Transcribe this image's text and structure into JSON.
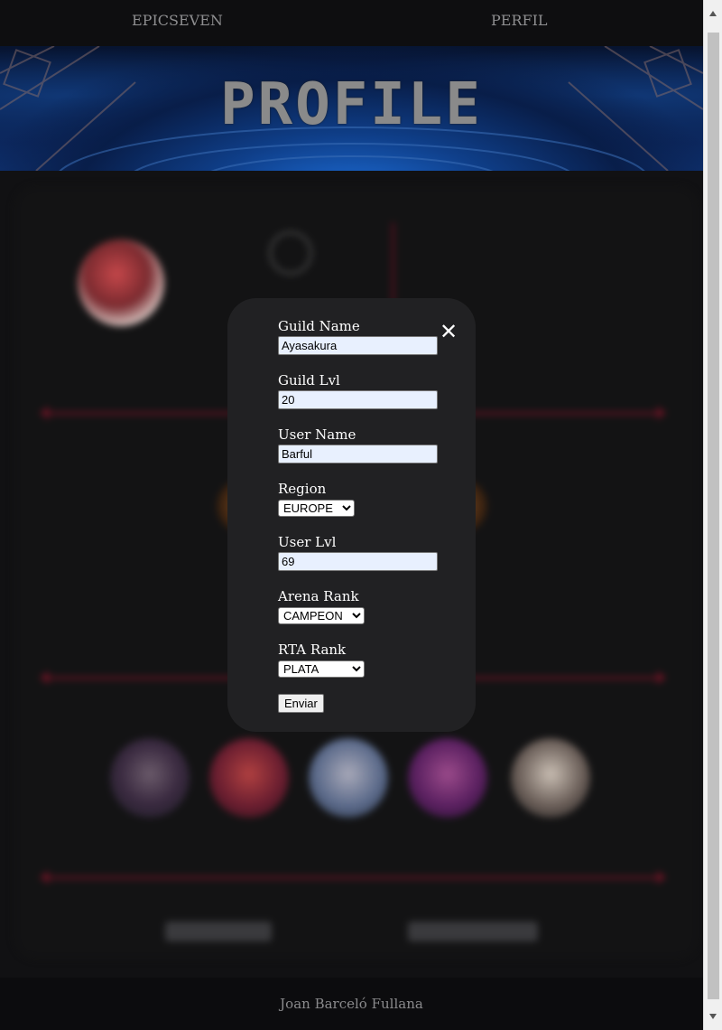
{
  "nav": {
    "brand": "EPICSEVEN",
    "profile_link": "PERFIL"
  },
  "hero": {
    "title": "PROFILE"
  },
  "footer": {
    "author": "Joan Barceló Fullana"
  },
  "modal": {
    "close_glyph": "✕",
    "fields": {
      "guild_name": {
        "label": "Guild Name",
        "value": "Ayasakura"
      },
      "guild_lvl": {
        "label": "Guild Lvl",
        "value": "20"
      },
      "user_name": {
        "label": "User Name",
        "value": "Barful"
      },
      "region": {
        "label": "Region",
        "selected": "EUROPE"
      },
      "user_lvl": {
        "label": "User Lvl",
        "value": "69"
      },
      "arena_rank": {
        "label": "Arena Rank",
        "selected": "CAMPEON"
      },
      "rta_rank": {
        "label": "RTA Rank",
        "selected": "PLATA"
      }
    },
    "submit_label": "Enviar"
  },
  "colors": {
    "page_bg": "#111113",
    "modal_bg": "#212123",
    "accent_line": "#6a1424",
    "autofill_bg": "#e8f0fe"
  }
}
